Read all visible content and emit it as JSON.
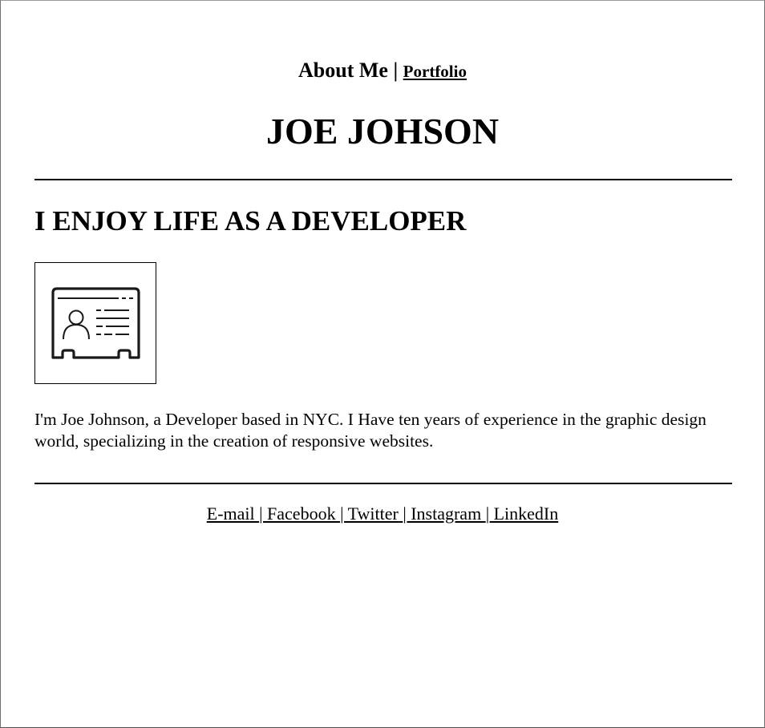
{
  "nav": {
    "current": "About Me",
    "separator": "|",
    "portfolio_link": "Portfolio"
  },
  "site": {
    "title": "JOE JOHSON"
  },
  "main": {
    "headline": "I ENJOY LIFE AS A DEVELOPER",
    "profile_icon": "id-card-icon",
    "bio": "I'm Joe Johnson, a Developer based in NYC. I Have ten years of experience in the graphic design world, specializing in the creation of responsive websites."
  },
  "footer": {
    "links": [
      "E-mail ",
      "| Facebook ",
      "| Twitter ",
      "| Instagram ",
      "| LinkedIn"
    ]
  }
}
